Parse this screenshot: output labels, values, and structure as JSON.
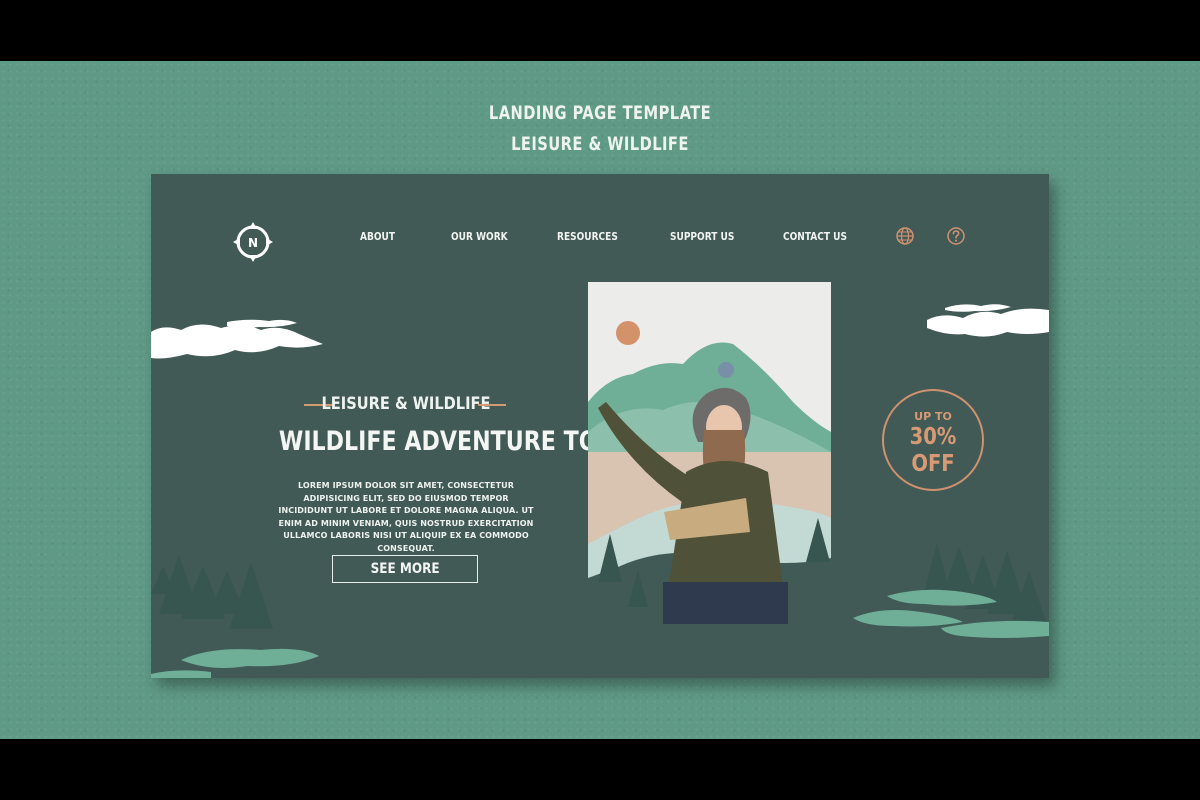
{
  "header": {
    "line1": "LANDING PAGE TEMPLATE",
    "line2": "LEISURE & WILDLIFE"
  },
  "site": {
    "logo_letter": "N",
    "nav": [
      {
        "label": "ABOUT"
      },
      {
        "label": "OUR WORK"
      },
      {
        "label": "RESOURCES"
      },
      {
        "label": "SUPPORT US"
      },
      {
        "label": "CONTACT US"
      }
    ],
    "icons": {
      "language": "globe-icon",
      "help": "help-icon",
      "logo": "compass-icon"
    }
  },
  "hero": {
    "eyebrow": "LEISURE & WILDLIFE",
    "title": "WILDLIFE ADVENTURE TOUR",
    "body": "LOREM IPSUM DOLOR SIT AMET, CONSECTETUR ADIPISICING ELIT, SED DO EIUSMOD TEMPOR INCIDIDUNT UT LABORE ET DOLORE MAGNA ALIQUA. UT ENIM AD MINIM VENIAM, QUIS NOSTRUD EXERCITATION ULLAMCO LABORIS NISI UT ALIQUIP EX EA COMMODO CONSEQUAT.",
    "cta": "SEE MORE"
  },
  "promo": {
    "prefix": "UP TO",
    "value": "30%",
    "suffix": "OFF"
  },
  "colors": {
    "backdrop": "#5f9a86",
    "panel": "#425a55",
    "accent": "#cf9170",
    "light_green": "#6fae97",
    "paper": "#ececea"
  }
}
